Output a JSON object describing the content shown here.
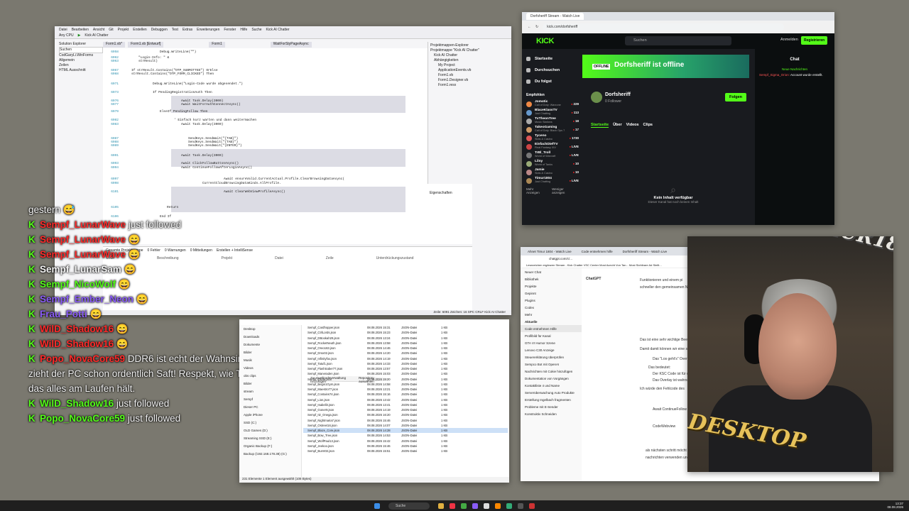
{
  "vs": {
    "menu": [
      "Datei",
      "Bearbeiten",
      "Ansicht",
      "Git",
      "Projekt",
      "Erstellen",
      "Debuggen",
      "Test",
      "Extras",
      "Erweiterungen",
      "Fenster",
      "Hilfe",
      "Suche",
      "Kick AI Chatter"
    ],
    "toolbar": [
      "Any CPU",
      "Kick AI Chatter"
    ],
    "solution_tree": [
      "Solution Explorer",
      "Suchen",
      "CodGaryLi.WinForms",
      "Allgemein",
      "Zeilen",
      "HTML Ausschnitt"
    ],
    "tabs": [
      "Form1.vb*",
      "Form1.vb [Entwurf]",
      "Form1",
      "WaitForStyPageAsync"
    ],
    "code": [
      {
        "n": "6058",
        "t": "Debug.WriteLine(\"\")"
      },
      {
        "n": "6062",
        "t": "\"Login-Info: \" &"
      },
      {
        "n": "6063",
        "t": "strResult)"
      },
      {
        "n": "6067",
        "t": "If strResult.Contains(\"OTP_SUBMITTED\") OrElse"
      },
      {
        "n": "6068",
        "t": "strResult.Contains(\"OTP_FORM_CLICKED\") Then"
      },
      {
        "n": "6071",
        "t": "Debug.WriteLine(\"Login-Code wurde abgesendet.\")"
      },
      {
        "n": "6073",
        "t": "If PendingRegistrationAuth Then"
      },
      {
        "n": "6076",
        "t": "Await Task.Delay(3000)"
      },
      {
        "n": "6077",
        "t": "Await WaitForAuthConnectAsync()"
      },
      {
        "n": "6079",
        "t": "ElseIf PendingFollow Then"
      },
      {
        "n": "6082",
        "t": "' Einfach kurz warten und dann weitermachen"
      },
      {
        "n": "6083",
        "t": "Await Task.Delay(3000)"
      },
      {
        "n": "6087",
        "t": "SendKeys.SendWait(\"{TAB}\")"
      },
      {
        "n": "6088",
        "t": "SendKeys.SendWait(\"{TAB}\")"
      },
      {
        "n": "6089",
        "t": "SendKeys.SendWait(\"{ENTER}\")"
      },
      {
        "n": "6091",
        "t": "Await Task.Delay(3000)"
      },
      {
        "n": "6093",
        "t": "Await ClickFollowButtonAsync()"
      },
      {
        "n": "6094",
        "t": "Await ContinueFollowAfterLoginAsync()"
      },
      {
        "n": "6097",
        "t": "Await ensureValid.CurrentActual.Profile.ClearBrowsingDataAsync("
      },
      {
        "n": "6098",
        "t": "CurrentCloudBrowsingDataKinds.AllProfile."
      },
      {
        "n": "6101",
        "t": "Await ClearWebViewProfileAsync()"
      },
      {
        "n": "6105",
        "t": "Return"
      },
      {
        "n": "6106",
        "t": "End If"
      }
    ],
    "side": [
      "Projektmappen-Explorer",
      "Projektmappe \"Kick AI Chatter\"",
      "Kick AI Chatter",
      "Abhängigkeiten",
      "My Project",
      "ApplicationEvents.vb",
      "Form1.vb",
      "Form1.Designer.vb",
      "Form1.resx"
    ],
    "props_title": "Eigenschaften",
    "error_tabs": [
      "Gesamte Projektmappe",
      "0 Fehler",
      "0 Warnungen",
      "0 Mitteilungen",
      "Erstellen + IntelliSense"
    ],
    "error_cols": [
      "Code",
      "Beschreibung",
      "Projekt",
      "Datei",
      "Zeile",
      "Unterdrückungszustand"
    ],
    "status": "Zeile: 6091  Zeichen: 16  SPC  CRLF  Kick AI Chatter"
  },
  "chat": [
    {
      "user": "",
      "text": "gestern 😅",
      "color": "plain"
    },
    {
      "user": "Sempf_LunarWave",
      "text": "just followed",
      "color": "red"
    },
    {
      "user": "Sempf_LunarWave",
      "text": "😄",
      "color": "red"
    },
    {
      "user": "Sempf_LunarWave",
      "text": "😄",
      "color": "red"
    },
    {
      "user": "Sempf_LunarSam",
      "text": "😄",
      "color": "white"
    },
    {
      "user": "Sempf_NicoWolf",
      "text": "😄",
      "color": "green"
    },
    {
      "user": "Sempf_Ember_Neon",
      "text": "😄",
      "color": "purple"
    },
    {
      "user": "Frau_Potti",
      "text": "😄",
      "color": "purple"
    },
    {
      "user": "WilD_Shadow16",
      "text": "😄",
      "color": "red"
    },
    {
      "user": "WilD_Shadow16",
      "text": "😄",
      "color": "red"
    },
    {
      "user": "Popo_NovaCore59",
      "text": "DDR6 ist echt der Wahnsinn, da",
      "color": "red"
    },
    {
      "user": "",
      "text": "zieht der PC schon ordentlich Saft! Respekt, wie Timur",
      "color": "plain"
    },
    {
      "user": "",
      "text": "das alles am Laufen hält.",
      "color": "plain"
    },
    {
      "user": "WilD_Shadow16",
      "text": "just followed",
      "color": "green"
    },
    {
      "user": "Popo_NovaCore59",
      "text": "just followed",
      "color": "green"
    }
  ],
  "explorer": {
    "toolbar": [
      "Zur Quellcodeverwaltung hinzufügen",
      "Repository auswählen"
    ],
    "nav": [
      "Desktop",
      "Downloads",
      "Dokumente",
      "Bilder",
      "Musik",
      "Videos",
      "obs clips",
      "Bilder",
      "stream",
      "Sempf",
      "Dieser PC",
      "Apple iPhone",
      "SSD (C:)",
      "OLD Games (D:)",
      "Streaming SSD (E:)",
      "Organic Backup (F:)",
      "Backup (\\192.168.178.38) (G:)"
    ],
    "files": [
      [
        "Sempf_Cardhopper.json",
        "08.08.2026 15:31",
        "JSON-Datei",
        "1 KB"
      ],
      [
        "Sempf_CtrlLords.json",
        "08.08.2026 15:23",
        "JSON-Datei",
        "1 KB"
      ],
      [
        "Sempf_DBookah29.json",
        "08.08.2026 13:24",
        "JSON-Datei",
        "1 KB"
      ],
      [
        "Sempf_RocketNeuth.json",
        "08.08.2026 13:58",
        "JSON-Datei",
        "1 KB"
      ],
      [
        "Sempf_Oreo163.json",
        "08.08.2026 14:46",
        "JSON-Datei",
        "1 KB"
      ],
      [
        "Sempf_Drox02.json",
        "08.08.2026 14:20",
        "JSON-Datei",
        "1 KB"
      ],
      [
        "Sempf_Infinityfox.json",
        "08.08.2026 14:19",
        "JSON-Datei",
        "1 KB"
      ],
      [
        "Sempf_Tatuf1.json",
        "08.08.2026 14:33",
        "JSON-Datei",
        "1 KB"
      ],
      [
        "Sempf_FlashSaber77.json",
        "08.08.2026 13:57",
        "JSON-Datei",
        "1 KB"
      ],
      [
        "Sempf_Maneraden.json",
        "08.08.2026 15:03",
        "JSON-Datei",
        "1 KB"
      ],
      [
        "Sempf_Tacita.json",
        "08.08.2026 15:20",
        "JSON-Datei",
        "1 KB"
      ],
      [
        "Sempf_Begin1Gym.json",
        "08.08.2026 14:58",
        "JSON-Datei",
        "1 KB"
      ],
      [
        "Sempf_Maestro77.json",
        "08.08.2026 13:21",
        "JSON-Datei",
        "1 KB"
      ],
      [
        "Sempf_Contains74.json",
        "08.08.2026 15:16",
        "JSON-Datei",
        "1 KB"
      ],
      [
        "Sempf_Lion.json",
        "08.08.2026 13:42",
        "JSON-Datei",
        "1 KB"
      ],
      [
        "Sempf_Isabell3.json",
        "08.08.2026 13:41",
        "JSON-Datei",
        "1 KB"
      ],
      [
        "Sempf_Goner9.json",
        "08.08.2026 14:19",
        "JSON-Datei",
        "1 KB"
      ],
      [
        "Sempf_Itz_Onega.json",
        "08.08.2026 16:20",
        "JSON-Datei",
        "1 KB"
      ],
      [
        "Sempf_Nightmaria7.json",
        "08.08.2026 15:46",
        "JSON-Datei",
        "1 KB"
      ],
      [
        "Sempf_Ostreet16.json",
        "08.08.2026 14:07",
        "JSON-Datei",
        "1 KB"
      ],
      [
        "Sempf_Blaze_Core.json",
        "08.08.2026 14:28",
        "JSON-Datei",
        "1 KB"
      ],
      [
        "Sempf_Bow_Tree.json",
        "08.08.2026 14:53",
        "JSON-Datei",
        "1 KB"
      ],
      [
        "Sempf_WolfPaul13.json",
        "08.08.2026 15:42",
        "JSON-Datei",
        "1 KB"
      ],
      [
        "Sempf_Jeekoo.json",
        "08.08.2026 15:46",
        "JSON-Datei",
        "1 KB"
      ],
      [
        "Sempf_Burnt02.json",
        "08.08.2026 15:51",
        "JSON-Datei",
        "1 KB"
      ]
    ],
    "selected_index": 20,
    "status": "231 Elemente   1 Element ausgewählt (108 Bytes)"
  },
  "kick": {
    "tab": "Dorfsheriff Stream - Watch Live",
    "url": "kick.com/dorfsheriff",
    "logo": "KICK",
    "search_placeholder": "Suchen",
    "login": "Anmelden",
    "register": "Registrieren",
    "nav": [
      "Startseite",
      "Durchsuchen",
      "Du folgst"
    ],
    "following_title": "Empfohlen",
    "channels": [
      {
        "name": "Jomotic",
        "cat": "Call of Duty: Warzone",
        "viewers": "229",
        "color": "#e84"
      },
      {
        "name": "BlaceKlassTV",
        "cat": "Just Chatting",
        "viewers": "113",
        "color": "#69c"
      },
      {
        "name": "TvTheonTree",
        "cat": "Music Stations",
        "viewers": "18",
        "color": "#aaa"
      },
      {
        "name": "TakeoGaming",
        "cat": "Call of Duty: Black Ops 7",
        "viewers": "17",
        "color": "#c96"
      },
      {
        "name": "Tyceno",
        "cat": "Slots & Casino",
        "viewers": "1730",
        "color": "#d55"
      },
      {
        "name": "EinfachDiefTV",
        "cat": "Final Fantasy XIV",
        "viewers": "LIVE",
        "color": "#c44"
      },
      {
        "name": "TrBl_Troll",
        "cat": "World of Warcraft",
        "viewers": "LIVE",
        "color": "#777"
      },
      {
        "name": "Lilny",
        "cat": "World of Tanks",
        "viewers": "10",
        "color": "#9a7"
      },
      {
        "name": "Jamie",
        "cat": "Slots & Casino",
        "viewers": "10",
        "color": "#b88"
      },
      {
        "name": "Timur1804",
        "cat": "Just Chatting",
        "viewers": "LIVE",
        "color": "#a85"
      }
    ],
    "show_more": [
      "Mehr Anzeigen",
      "Weniger anzeigen"
    ],
    "offline_badge": "OFFLINE",
    "offline_text": "Dorfsheriff ist offline",
    "channel_name": "Dorfsheriff",
    "followers": "0 Follower",
    "follow_btn": "Folgen",
    "tabs": [
      "Startseite",
      "Über",
      "Videos",
      "Clips"
    ],
    "empty_title": "Kein Inhalt verfügbar",
    "empty_sub": "Dieser Kanal hat noch keinen Inhalt",
    "chat_title": "Chat",
    "chat_new": "Neue Nachrichten",
    "chat_msg_user": "Sempf_Sigma_Orion:",
    "chat_msg": "Account wurde erstellt."
  },
  "gpt": {
    "tabs": [
      "Ahnet Timur 1804 - Watch Live",
      "Code entnehmen hilfe",
      "Dorfsheriff Stream - Watch Live"
    ],
    "url": "chatgpt.com/c/...",
    "bookmarks": "Lesezeichen ergänzen   Stream - Kick Chatter   VSC Center   Most Acecht Von Tan...   Most Sichtbare Ad Stellt...",
    "sidebar": [
      "Neuer Chat",
      "Bibliothek",
      "Projekte",
      "Gepinnt",
      "Plugins",
      "Codex",
      "Mehr",
      "Aktuelle",
      "Code entnehmen Hilfe",
      "Profilbild für Kanal",
      "GTA VI Humor Szene",
      "Lenovo C30 Anzeige",
      "Steuererklärung überprüfen",
      "Sempco Bot mit OpenAI",
      "Nachrichten mit Cokie hinzufügen",
      "Dokumentation von Vorgängen",
      "Kontaktliste 4 und Name",
      "Serverüberwachung Auto Produkte",
      "Erstellung Ingelbach fragmenten",
      "Probleme mit E-Sender",
      "Konstruktiv Schneiden"
    ],
    "model": "ChatGPT",
    "lines": [
      "Funktionieren und einem pi",
      "schneller den gemeinsamen N",
      "Das ist eine sehr wichtige Bee",
      "Damit damit können wir eine s",
      "Das \"Los geht's\" Overl",
      "Das bedeutet:",
      "Der KSC Code ist für de",
      "Das Overlay ist wahrsch",
      "Ich würde den Fehlcode des",
      "Await ContinueFollow",
      "CodeWebview",
      "als nächsten schritt möcht",
      "nachrichten verwenden und"
    ]
  },
  "stream": {
    "overlay_top": "TIMUR1804",
    "overlay_bottom": "DESKTOP"
  },
  "taskbar": {
    "search": "Suche",
    "time": "13:37",
    "date": "08.08.2026"
  }
}
